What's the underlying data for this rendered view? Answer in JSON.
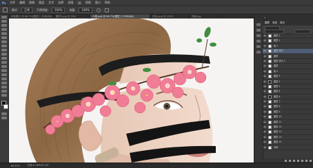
{
  "app": {
    "title": "Ps"
  },
  "menu": [
    "文件",
    "编辑",
    "图像",
    "图层",
    "文字",
    "选择",
    "滤镜",
    "3D",
    "视图",
    "窗口",
    "帮助"
  ],
  "options": {
    "mode_label": "模式",
    "mode_value": "正常",
    "opacity_label": "不透明度",
    "opacity_value": "100%",
    "flow_label": "流量",
    "flow_value": "100%"
  },
  "tabs": [
    {
      "label": "未标题-1 @ 66.7%(图层 1, RGB/8#)",
      "active": false
    },
    {
      "label": "素材1.jpg @ 50%",
      "active": false
    },
    {
      "label": "人物.psd @ 66.7%(图层 2, RGB/8#)",
      "active": true
    },
    {
      "label": "花朵.png @ 100%",
      "active": false
    },
    {
      "label": "背景.jpg",
      "active": false
    }
  ],
  "panel": {
    "tabs": [
      "图层",
      "通道",
      "路径"
    ]
  },
  "layers": [
    {
      "name": "图层 2",
      "selected": false,
      "dark": false
    },
    {
      "name": "图层 2",
      "selected": false,
      "dark": false
    },
    {
      "name": "组 1",
      "selected": false,
      "dark": false
    },
    {
      "name": "图层 拷贝",
      "selected": true,
      "dark": false
    },
    {
      "name": "图层",
      "selected": false,
      "dark": false
    },
    {
      "name": "图层 拷贝 2",
      "selected": false,
      "dark": false
    },
    {
      "name": "图层",
      "selected": false,
      "dark": false
    },
    {
      "name": "组 5",
      "selected": false,
      "dark": false
    },
    {
      "name": "图层 3",
      "selected": false,
      "dark": false
    },
    {
      "name": "图层 4",
      "selected": false,
      "dark": true
    },
    {
      "name": "图层 5",
      "selected": false,
      "dark": false
    },
    {
      "name": "图层 6",
      "selected": false,
      "dark": false
    },
    {
      "name": "图层 6",
      "selected": false,
      "dark": true
    },
    {
      "name": "图层 7",
      "selected": false,
      "dark": false
    },
    {
      "name": "图层 8",
      "selected": false,
      "dark": false
    },
    {
      "name": "图层 9",
      "selected": false,
      "dark": false
    },
    {
      "name": "图层 10",
      "selected": false,
      "dark": false
    },
    {
      "name": "图层 11",
      "selected": false,
      "dark": false
    },
    {
      "name": "图层 12",
      "selected": false,
      "dark": false
    },
    {
      "name": "图层 13",
      "selected": false,
      "dark": false
    },
    {
      "name": "图层 14",
      "selected": false,
      "dark": false
    },
    {
      "name": "图层 15",
      "selected": false,
      "dark": false
    },
    {
      "name": "背景",
      "selected": false,
      "dark": false
    }
  ],
  "status": {
    "zoom": "66.67%",
    "doc": "文档:6.18M/92.3M"
  },
  "colors": {
    "menubar": "#3a3a3a",
    "selection": "#4f5c73",
    "canvas_bg": "#f6f4f2"
  }
}
